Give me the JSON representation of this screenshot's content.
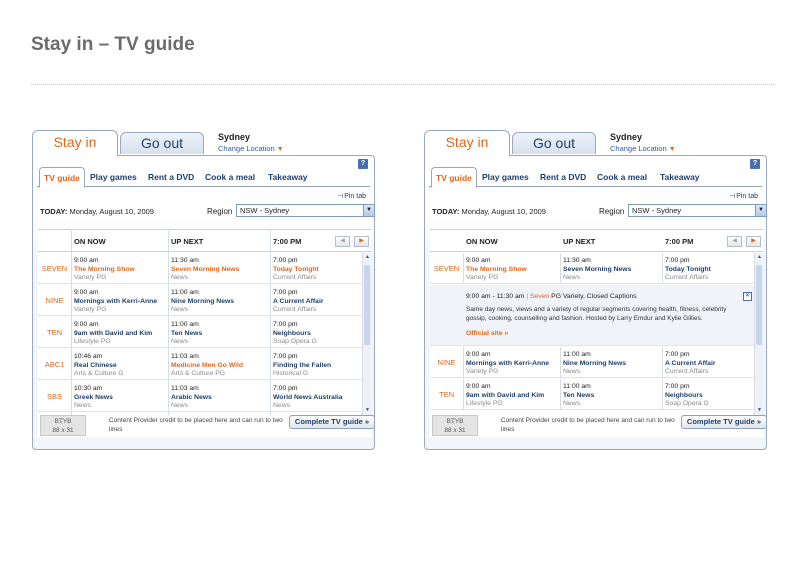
{
  "page": {
    "title": "Stay in – TV guide"
  },
  "widget": {
    "tabs": {
      "stay_in": "Stay in",
      "go_out": "Go out"
    },
    "location": {
      "city": "Sydney",
      "change": "Change Location",
      "caret": "▼"
    },
    "help": "?",
    "subtabs": [
      "TV guide",
      "Play games",
      "Rent a DVD",
      "Cook a meal",
      "Takeaway"
    ],
    "pin_tab": "Pin tab",
    "today": {
      "label": "TODAY:",
      "date": "Monday, August 10, 2009"
    },
    "region": {
      "label": "Region",
      "value": "NSW - Sydney"
    },
    "columns": {
      "now": "ON NOW",
      "next": "UP NEXT",
      "later": "7:00 PM"
    },
    "nav": {
      "prev": "◀",
      "next": "▶"
    },
    "channels": [
      {
        "name": "SEVEN",
        "now": {
          "time": "9:00 am",
          "title": "The Morning Show",
          "genre": "Variety PG"
        },
        "next": {
          "time": "11:30 am",
          "title": "Seven Morning News",
          "genre": "News"
        },
        "later": {
          "time": "7:00 pm",
          "title": "Today Tonight",
          "genre": "Current Affairs"
        }
      },
      {
        "name": "NINE",
        "now": {
          "time": "9:00 am",
          "title": "Mornings with Kerri-Anne",
          "genre": "Variety PG"
        },
        "next": {
          "time": "11:00 am",
          "title": "Nine Morning News",
          "genre": "News"
        },
        "later": {
          "time": "7:00 pm",
          "title": "A Current Affair",
          "genre": "Current Affairs"
        }
      },
      {
        "name": "TEN",
        "now": {
          "time": "9:00 am",
          "title": "9am with David and Kim",
          "genre": "Lifestyle PG"
        },
        "next": {
          "time": "11:00 am",
          "title": "Ten News",
          "genre": "News"
        },
        "later": {
          "time": "7:00 pm",
          "title": "Neighbours",
          "genre": "Soap Opera G"
        }
      },
      {
        "name": "ABC1",
        "now": {
          "time": "10:46 am",
          "title": "Real Chinese",
          "genre": "Arts & Culture G"
        },
        "next": {
          "time": "11:03 am",
          "title": "Medicine Men Go Wild",
          "genre": "Arts & Culture PG"
        },
        "later": {
          "time": "7:00 pm",
          "title": "Finding the Fallen",
          "genre": "Historical G"
        }
      },
      {
        "name": "SBS",
        "now": {
          "time": "10:30 am",
          "title": "Greek News",
          "genre": "News"
        },
        "next": {
          "time": "11:03 am",
          "title": "Arabic News",
          "genre": "News"
        },
        "later": {
          "time": "7:00 pm",
          "title": "World News Australia",
          "genre": "News"
        }
      }
    ],
    "detail": {
      "time_range": "9:00 am - 11:30 am",
      "separator": "|",
      "channel": "Seven",
      "meta": "PG Variety, Closed Captions",
      "description": "Same day news, views and a variety of regular segments covering health, fitness, celebrity gossip, cooking, counselling and fashion. Hosted by Larry Emdur and Kylie Gillies.",
      "official_site": "Official site »",
      "close": "✕"
    },
    "footer": {
      "ad_line1": "BTYB",
      "ad_line2": "88 x 31",
      "credit": "Content Provider credit to be placed here and can run to two lines",
      "complete_button": "Complete TV guide »"
    }
  },
  "colors": {
    "accent": "#e0671a",
    "link": "#1f3f6a",
    "border": "#9aa8bd"
  }
}
